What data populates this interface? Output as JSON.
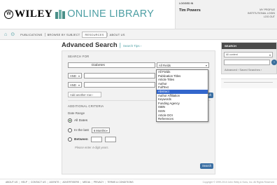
{
  "brand": {
    "seal_label": "W",
    "wiley_label": "WILEY",
    "library_label": "ONLINE LIBRARY",
    "accent_color": "#4c9ea3"
  },
  "account": {
    "status_label": "LOGGED IN",
    "user_name": "Tim Powers",
    "links": [
      "MY PROFILE",
      "INSTITUTIONAL LOGIN",
      "LOG OUT"
    ]
  },
  "nav": {
    "icons": [
      "home-icon",
      "back-icon"
    ],
    "items": [
      "PUBLICATIONS",
      "BROWSE BY SUBJECT",
      "RESOURCES",
      "ABOUT US"
    ],
    "active_item": "RESOURCES"
  },
  "sidebar_search": {
    "heading": "SEARCH",
    "scope_value": "All content",
    "go_label": "›",
    "advanced_link": "Advanced",
    "saved_link": "Saved Searches",
    "sep": "›"
  },
  "form": {
    "title": "Advanced Search",
    "tips_link": "Search Tips ›",
    "search_for_label": "SEARCH FOR",
    "rows": [
      {
        "operator": "",
        "term": "Diabetes",
        "field": "All Fields"
      },
      {
        "operator": "AND",
        "term": "",
        "field": ""
      },
      {
        "operator": "AND",
        "term": "",
        "field": ""
      }
    ],
    "add_row_label": "Add another row ›",
    "search_button_label": "Search",
    "additional_label": "ADDITIONAL CRITERIA",
    "date_range_label": "Date Range",
    "date_options": {
      "all_dates": "All Dates",
      "in_the_last": "In the last",
      "last_value": "6 Months",
      "between": "Between"
    },
    "year_hint": "Please enter 4-digit years.",
    "bottom_search_label": "Search"
  },
  "field_dropdown": {
    "options": [
      "All Fields",
      "Publication Titles",
      "Article Titles",
      "Author",
      "FullText",
      "Abstract",
      "Author Affiliation",
      "Keywords",
      "Funding Agency",
      "ISBN",
      "ISSN",
      "Article DOI",
      "References"
    ],
    "highlighted": "Abstract"
  },
  "footer": {
    "links": [
      "ABOUT US",
      "HELP",
      "CONTACT US",
      "AGENTS",
      "ADVERTISERS",
      "MEDIA",
      "PRIVACY",
      "TERMS & CONDITIONS"
    ],
    "copyright": "Copyright © 1999-2010 John Wiley & Sons, Inc. All Rights Reserved"
  }
}
